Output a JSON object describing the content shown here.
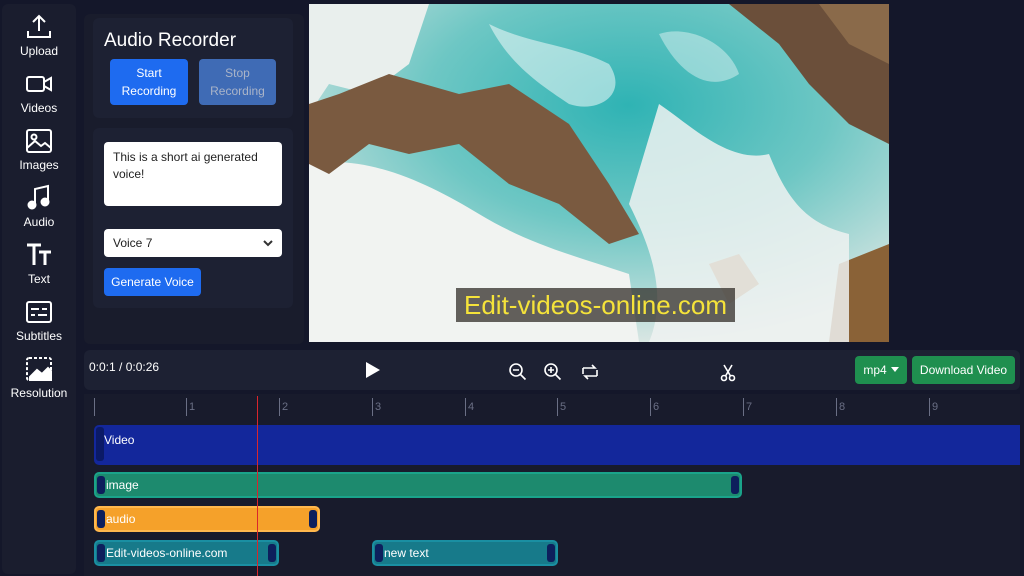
{
  "sidebar": {
    "items": [
      {
        "label": "Upload",
        "icon": "upload-icon"
      },
      {
        "label": "Videos",
        "icon": "video-camera-icon"
      },
      {
        "label": "Images",
        "icon": "image-icon"
      },
      {
        "label": "Audio",
        "icon": "music-note-icon"
      },
      {
        "label": "Text",
        "icon": "text-icon"
      },
      {
        "label": "Subtitles",
        "icon": "subtitles-icon"
      },
      {
        "label": "Resolution",
        "icon": "resolution-icon"
      }
    ]
  },
  "recorder": {
    "title": "Audio Recorder",
    "start_label": "Start Recording",
    "stop_label": "Stop Recording"
  },
  "voice": {
    "text_value": "This is a short ai generated voice!",
    "selected_voice": "Voice 7",
    "generate_label": "Generate Voice"
  },
  "preview": {
    "watermark": "Edit-videos-online.com"
  },
  "toolbar": {
    "time": "0:0:1 / 0:0:26",
    "format": "mp4",
    "download_label": "Download Video"
  },
  "timeline": {
    "ruler": [
      "1",
      "2",
      "3",
      "4",
      "5",
      "6",
      "7",
      "8",
      "9"
    ],
    "tracks": {
      "video": "Video",
      "image": "image",
      "audio": "audio",
      "text1": "Edit-videos-online.com",
      "text2": "new text"
    }
  },
  "colors": {
    "primary": "#1e6bf0",
    "success": "#1f8f4f",
    "video_track": "#13279b",
    "image_track": "#1d8a6e",
    "audio_track": "#f5a12a",
    "text_track": "#177a8a",
    "playhead": "#d9262c"
  }
}
